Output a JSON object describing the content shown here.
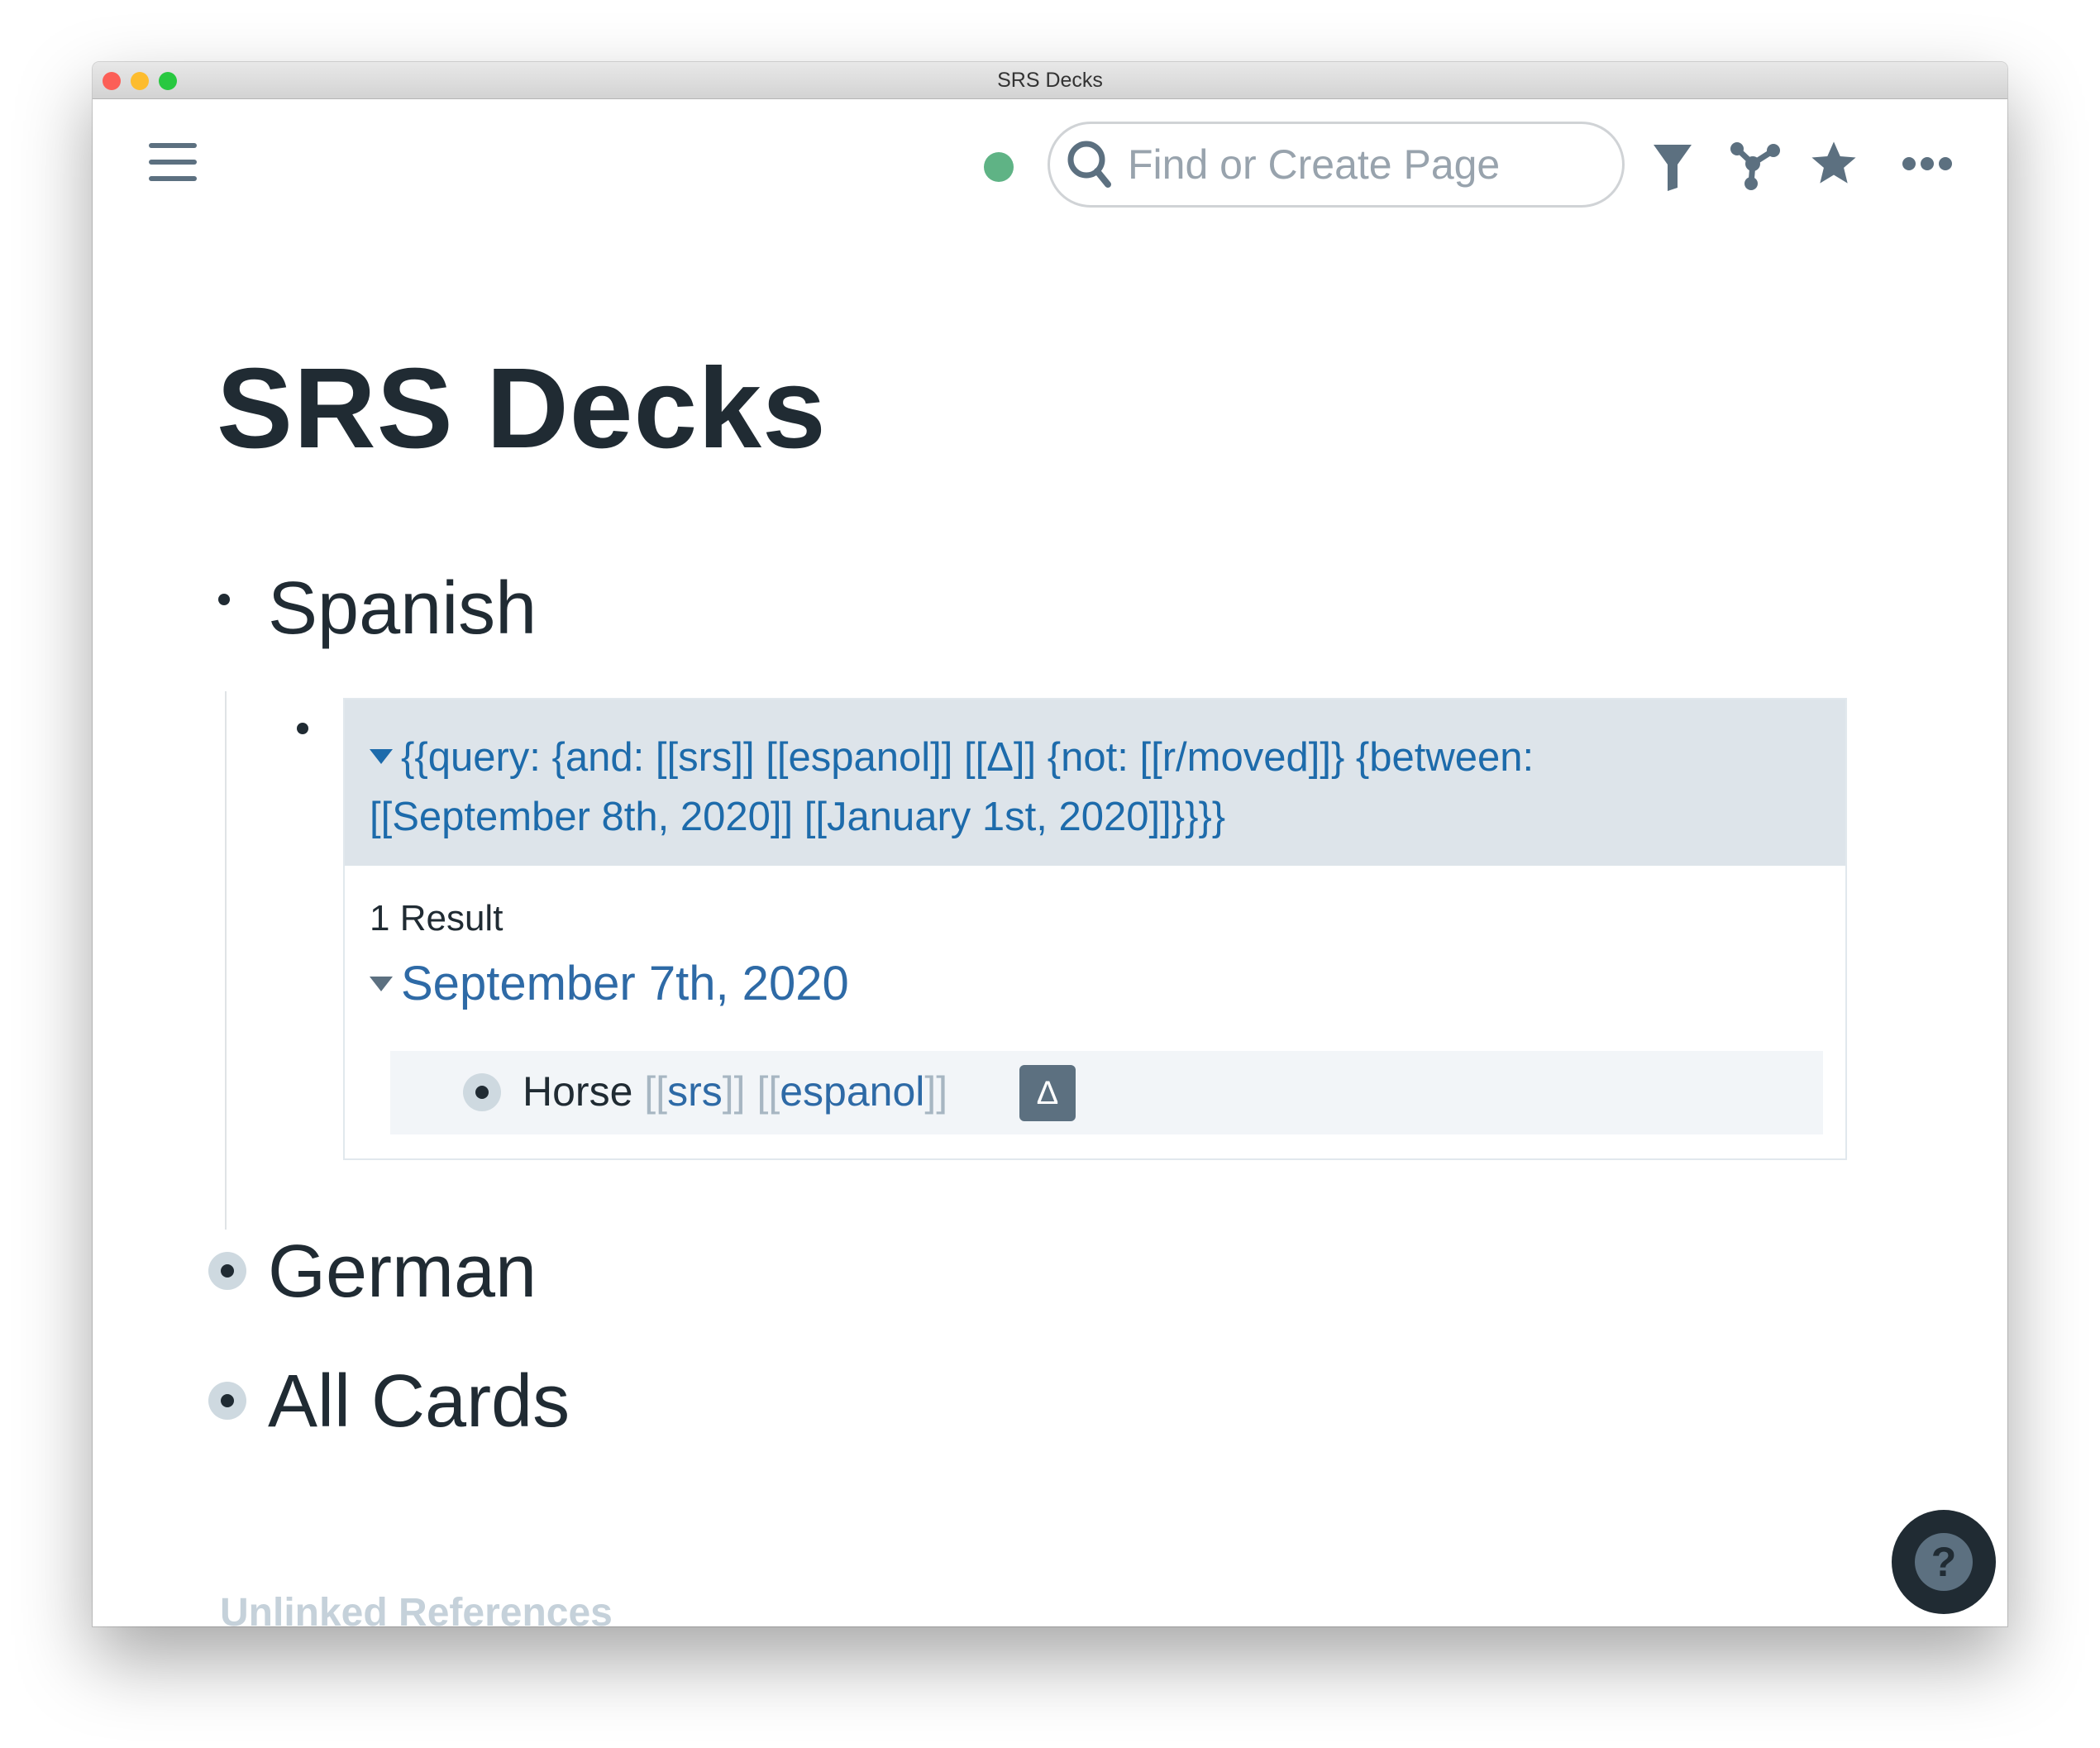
{
  "window": {
    "title": "SRS Decks"
  },
  "toolbar": {
    "search_placeholder": "Find or Create Page",
    "status_color": "#5fb385",
    "icons": [
      "menu-icon",
      "search-icon",
      "filter-icon",
      "graph-icon",
      "star-icon",
      "more-icon"
    ]
  },
  "page": {
    "title": "SRS Decks",
    "blocks": [
      {
        "label": "Spanish"
      },
      {
        "label": "German"
      },
      {
        "label": "All Cards"
      }
    ],
    "query": {
      "line1": "{{query:  {and: [[srs]] [[espanol]] [[Δ]] {not: [[r/moved]]} {between:",
      "line2": "[[September 8th, 2020]] [[January 1st, 2020]]}}}}",
      "result_count": "1 Result",
      "result_page": "September 7th, 2020",
      "result_block": {
        "text": "Horse",
        "open": "[[",
        "close": "]]",
        "tag1": "srs",
        "tag2": "espanol",
        "badge": "Δ"
      }
    },
    "unlinked": "Unlinked References"
  },
  "help": {
    "label": "?"
  }
}
